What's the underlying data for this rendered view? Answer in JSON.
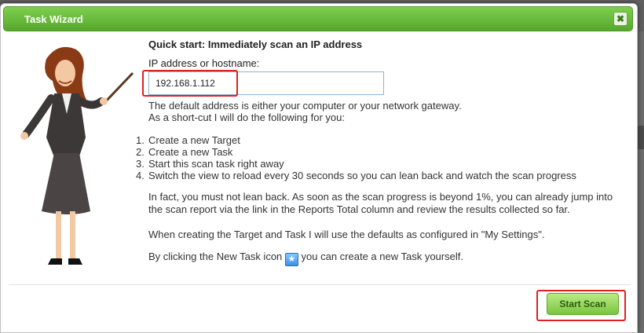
{
  "dialog": {
    "title": "Task Wizard",
    "close_symbol": "✖"
  },
  "quick_start": {
    "heading": "Quick start: Immediately scan an IP address",
    "ip_label": "IP address or hostname:",
    "ip_value": "192.168.1.112",
    "hint_line1": "The default address is either your computer or your network gateway.",
    "hint_line2": "As a short-cut I will do the following for you:"
  },
  "steps": [
    {
      "num": "1.",
      "text": "Create a new Target"
    },
    {
      "num": "2.",
      "text": "Create a new Task"
    },
    {
      "num": "3.",
      "text": "Start this scan task right away"
    },
    {
      "num": "4.",
      "text": "Switch the view to reload every 30 seconds so you can lean back and watch the scan progress"
    }
  ],
  "paragraphs": {
    "lean_back": "In fact, you must not lean back. As soon as the scan progress is beyond 1%, you can already jump into the scan report via the link in the Reports Total column and review the results collected so far.",
    "defaults": "When creating the Target and Task I will use the defaults as configured in \"My Settings\".",
    "new_task_before": "By clicking the New Task icon",
    "new_task_after": "you can create a new Task yourself."
  },
  "icons": {
    "new_task": "new-task-icon",
    "close": "close-icon"
  },
  "buttons": {
    "start_scan": "Start Scan"
  },
  "colors": {
    "titlebar": "#5fb535",
    "highlight": "#e02020",
    "button": "#8fd052"
  }
}
